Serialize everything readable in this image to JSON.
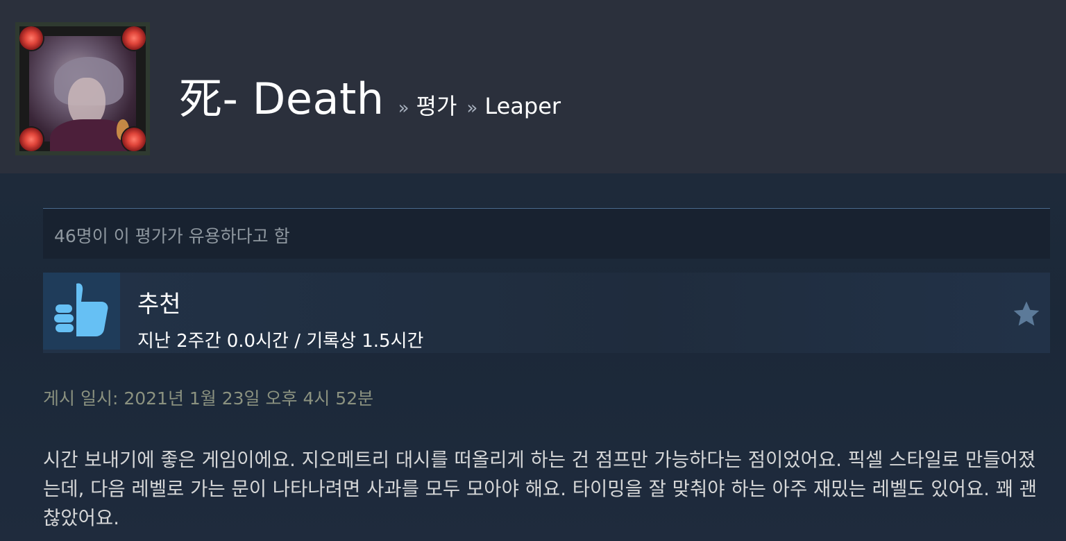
{
  "header": {
    "profile_name": "死- Death",
    "breadcrumb_sep": "»",
    "breadcrumb_section": "평가",
    "breadcrumb_game": "Leaper",
    "avatar_icon": "avatar-image"
  },
  "review": {
    "helpful_text": "46명이 이 평가가 유용하다고 함",
    "recommendation": "추천",
    "hours_text": "지난 2주간 0.0시간 / 기록상 1.5시간",
    "thumb_icon": "thumbs-up-icon",
    "award_icon": "star-icon",
    "posted_text": "게시 일시: 2021년 1월 23일 오후 4시 52분",
    "body_text": "시간 보내기에 좋은 게임이에요. 지오메트리 대시를 떠올리게 하는 건 점프만 가능하다는 점이었어요. 픽셀 스타일로 만들어졌는데, 다음 레벨로 가는 문이 나타나려면 사과를 모두 모아야 해요. 타이밍을 잘 맞춰야 하는 아주 재밌는 레벨도 있어요. 꽤 괜찮았어요."
  },
  "colors": {
    "page_bg": "#1b2838",
    "header_bg": "#2b303c",
    "thumb_bg": "#1f3c5a",
    "thumb_fg": "#66c0f4",
    "posted_color": "#8b9280",
    "star_color": "#5c7a99"
  }
}
